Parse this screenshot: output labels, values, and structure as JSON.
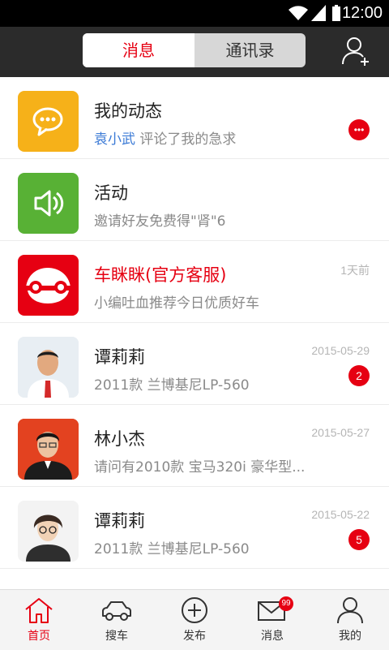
{
  "status_bar": {
    "time": "12:00"
  },
  "top_bar": {
    "tabs": [
      {
        "label": "消息",
        "active": true
      },
      {
        "label": "通讯录",
        "active": false
      }
    ]
  },
  "conversations": [
    {
      "name": "我的动态",
      "highlight": "袁小武",
      "message": "评论了我的急求",
      "time": "",
      "badge": "•••",
      "avatar": "chat-bubble-icon",
      "color": "#f6b119"
    },
    {
      "name": "活动",
      "highlight": "",
      "message": "邀请好友免费得\"肾\"6",
      "time": "",
      "badge": "",
      "avatar": "speaker-icon",
      "color": "#58b135"
    },
    {
      "name": "车眯眯(官方客服)",
      "highlight": "",
      "message": "小编吐血推荐今日优质好车",
      "time": "1天前",
      "badge": "",
      "avatar": "official-logo-icon",
      "color": "#e60012"
    },
    {
      "name": "谭莉莉",
      "highlight": "",
      "message": "2011款 兰博基尼LP-560",
      "time": "2015-05-29",
      "badge": "2",
      "avatar": "user-photo",
      "color": "#dfe7ef"
    },
    {
      "name": "林小杰",
      "highlight": "",
      "message": "请问有2010款 宝马320i 豪华型...",
      "time": "2015-05-27",
      "badge": "",
      "avatar": "user-photo",
      "color": "#e34220"
    },
    {
      "name": "谭莉莉",
      "highlight": "",
      "message": "2011款 兰博基尼LP-560",
      "time": "2015-05-22",
      "badge": "5",
      "avatar": "user-photo",
      "color": "#f2f2f2"
    }
  ],
  "bottom_nav": [
    {
      "label": "首页",
      "icon": "home-icon",
      "active": true,
      "badge": ""
    },
    {
      "label": "搜车",
      "icon": "car-icon",
      "active": false,
      "badge": ""
    },
    {
      "label": "发布",
      "icon": "plus-circle-icon",
      "active": false,
      "badge": ""
    },
    {
      "label": "消息",
      "icon": "mail-icon",
      "active": false,
      "badge": "99"
    },
    {
      "label": "我的",
      "icon": "person-icon",
      "active": false,
      "badge": ""
    }
  ],
  "colors": {
    "accent": "#e60012",
    "link": "#3b7ad6",
    "top_bar": "#2b2b2b"
  }
}
